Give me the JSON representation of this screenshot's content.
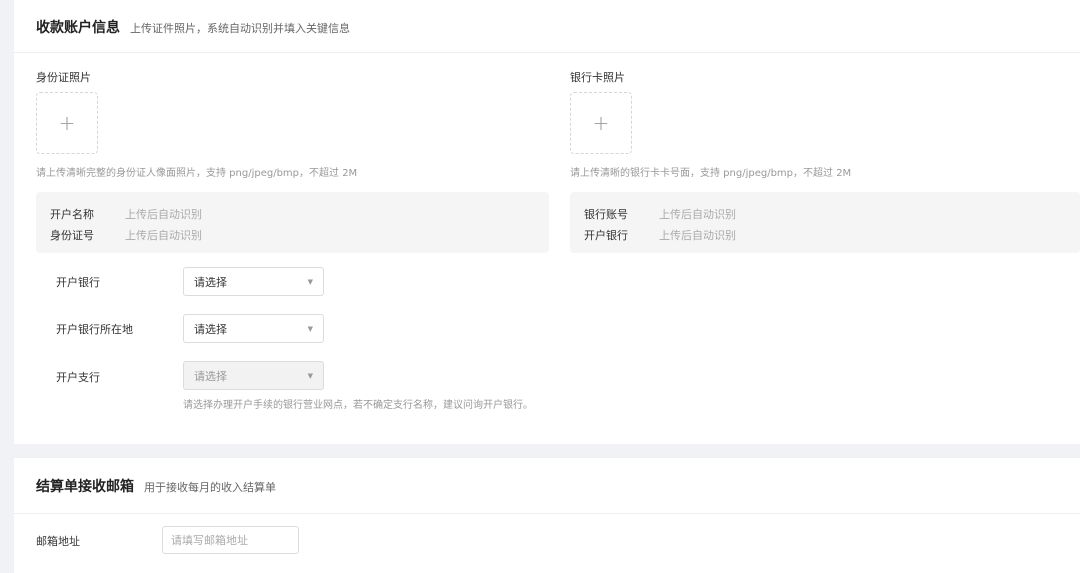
{
  "account_section": {
    "title": "收款账户信息",
    "subtitle": "上传证件照片，系统自动识别并填入关键信息",
    "id_card": {
      "label": "身份证照片",
      "upload_icon": "plus-icon",
      "hint": "请上传清晰完整的身份证人像面照片，支持 png/jpeg/bmp，不超过 2M",
      "fields": [
        {
          "key": "开户名称",
          "value": "上传后自动识别"
        },
        {
          "key": "身份证号",
          "value": "上传后自动识别"
        }
      ]
    },
    "bank_card": {
      "label": "银行卡照片",
      "upload_icon": "plus-icon",
      "hint": "请上传清晰的银行卡卡号面，支持 png/jpeg/bmp，不超过 2M",
      "fields": [
        {
          "key": "银行账号",
          "value": "上传后自动识别"
        },
        {
          "key": "开户银行",
          "value": "上传后自动识别"
        }
      ]
    },
    "form": {
      "bank": {
        "label": "开户银行",
        "value": "请选择"
      },
      "bank_location": {
        "label": "开户银行所在地",
        "value": "请选择"
      },
      "branch": {
        "label": "开户支行",
        "value": "请选择",
        "disabled": true,
        "hint": "请选择办理开户手续的银行营业网点，若不确定支行名称，建议问询开户银行。"
      }
    }
  },
  "email_section": {
    "title": "结算单接收邮箱",
    "subtitle": "用于接收每月的收入结算单",
    "email": {
      "label": "邮箱地址",
      "value": "",
      "placeholder": "请填写邮箱地址"
    }
  },
  "colors": {
    "page_background": "#f0f2f5",
    "card_background": "#ffffff",
    "info_panel_background": "#f5f5f5",
    "hint_text": "#999999"
  }
}
